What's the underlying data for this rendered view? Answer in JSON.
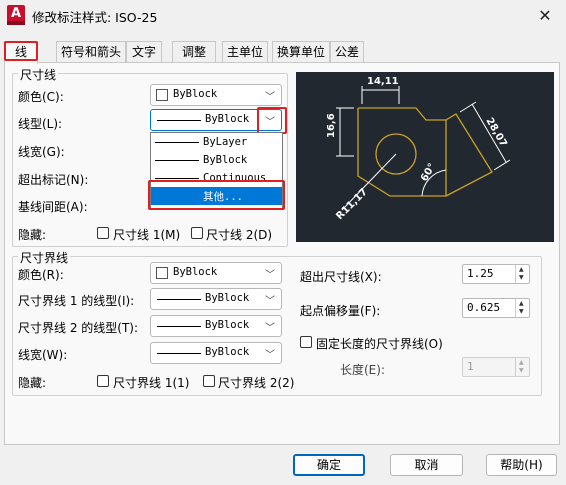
{
  "window": {
    "title": "修改标注样式: ISO-25",
    "close_glyph": "✕",
    "app_icon_letter": "A"
  },
  "tabs": [
    {
      "label": "线"
    },
    {
      "label": "符号和箭头"
    },
    {
      "label": "文字"
    },
    {
      "label": "调整"
    },
    {
      "label": "主单位"
    },
    {
      "label": "换算单位"
    },
    {
      "label": "公差"
    }
  ],
  "dim_lines": {
    "group_title": "尺寸线",
    "color_label": "颜色(C):",
    "color_value": "ByBlock",
    "linetype_label": "线型(L):",
    "linetype_value": "ByBlock",
    "lineweight_label": "线宽(G):",
    "extend_label": "超出标记(N):",
    "baseline_label": "基线间距(A):",
    "suppress_label": "隐藏:",
    "suppress_1": "尺寸线 1(M)",
    "suppress_2": "尺寸线 2(D)"
  },
  "dropdown": {
    "items": [
      "ByLayer",
      "ByBlock",
      "Continuous",
      "其他..."
    ],
    "selected_index": 3
  },
  "ext_lines": {
    "group_title": "尺寸界线",
    "color_label": "颜色(R):",
    "color_value": "ByBlock",
    "linetype1_label": "尺寸界线 1 的线型(I):",
    "linetype1_value": "ByBlock",
    "linetype2_label": "尺寸界线 2 的线型(T):",
    "linetype2_value": "ByBlock",
    "lineweight_label": "线宽(W):",
    "lineweight_value": "ByBlock",
    "suppress_label": "隐藏:",
    "suppress_1": "尺寸界线 1(1)",
    "suppress_2": "尺寸界线 2(2)",
    "extend_beyond_label": "超出尺寸线(X):",
    "extend_beyond_value": "1.25",
    "offset_label": "起点偏移量(F):",
    "offset_value": "0.625",
    "fixed_length_label": "固定长度的尺寸界线(O)",
    "length_label": "长度(E):",
    "length_value": "1"
  },
  "preview": {
    "dim_top": "14,11",
    "dim_left": "16,6",
    "dim_right": "28,07",
    "dim_angle": "60°",
    "dim_radius": "R11,17"
  },
  "buttons": {
    "ok": "确定",
    "cancel": "取消",
    "help": "帮助(H)"
  },
  "colors": {
    "highlight_red": "#e02020",
    "selection_blue": "#0078d7",
    "preview_bg": "#212830",
    "preview_geometry": "#c9a227",
    "preview_dims": "#ffffff"
  }
}
